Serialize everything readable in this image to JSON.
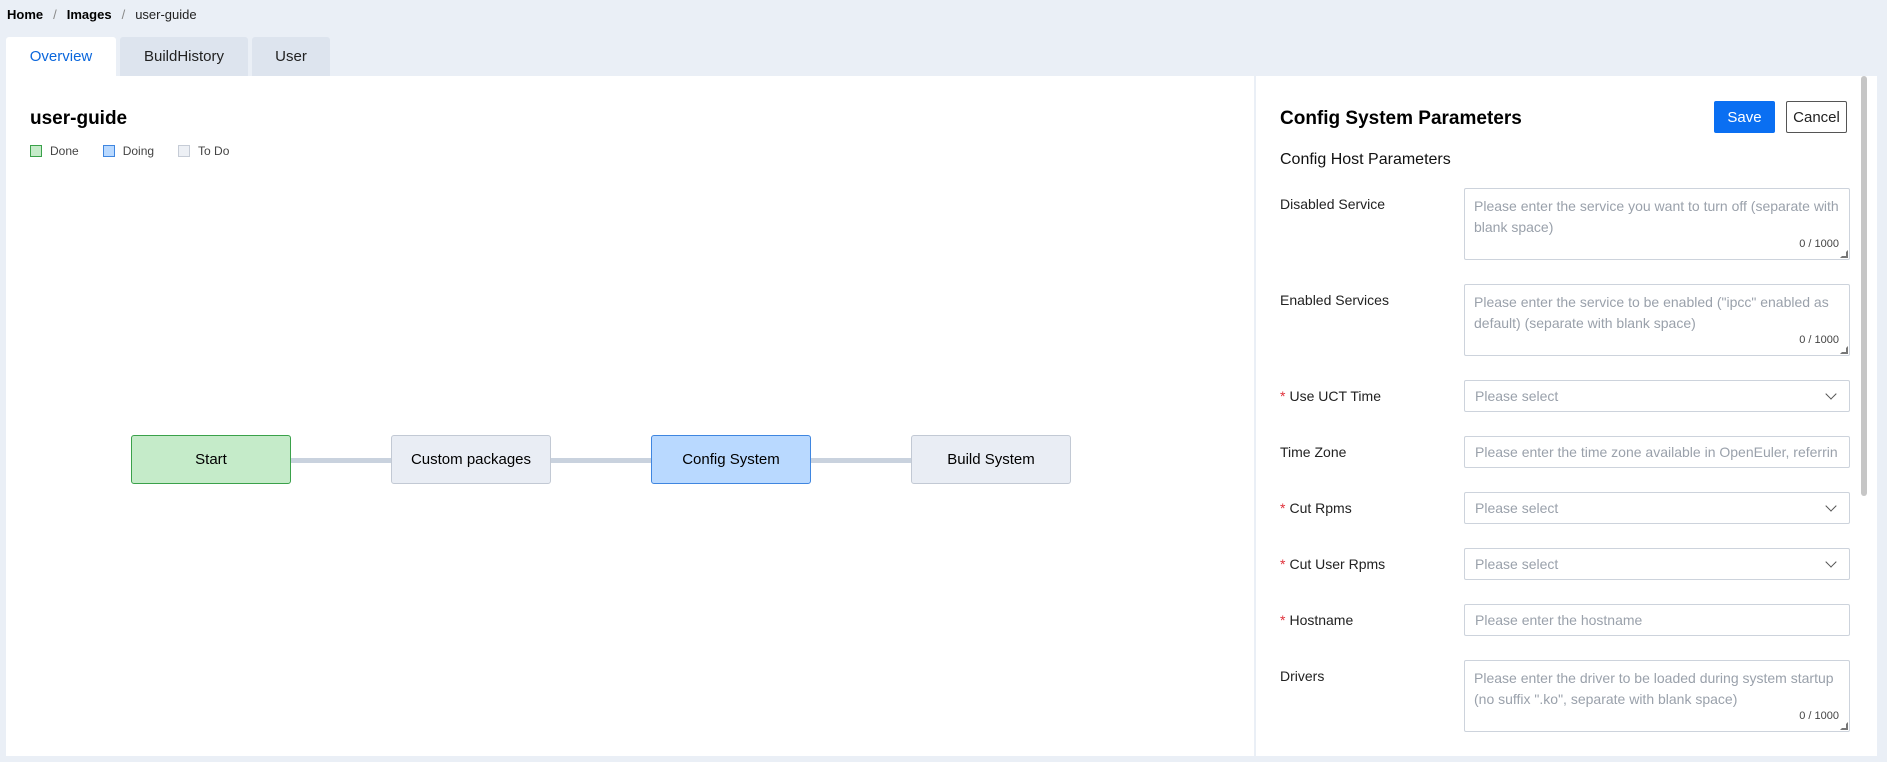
{
  "breadcrumb": {
    "home": "Home",
    "images": "Images",
    "current": "user-guide",
    "separator": "/"
  },
  "tabs": [
    {
      "label": "Overview",
      "active": true
    },
    {
      "label": "BuildHistory",
      "active": false
    },
    {
      "label": "User",
      "active": false
    }
  ],
  "overview": {
    "title": "user-guide",
    "legend": {
      "done": "Done",
      "doing": "Doing",
      "todo": "To Do"
    },
    "steps": [
      {
        "label": "Start",
        "status": "done"
      },
      {
        "label": "Custom packages",
        "status": "todo"
      },
      {
        "label": "Config System",
        "status": "doing"
      },
      {
        "label": "Build System",
        "status": "todo"
      }
    ],
    "colors": {
      "done": "#c5ebc9",
      "doing": "#b9d9ff",
      "todo": "#e9edf4"
    }
  },
  "config": {
    "title": "Config System Parameters",
    "save_label": "Save",
    "cancel_label": "Cancel",
    "subtitle": "Config Host Parameters",
    "required_mark": "*",
    "fields": {
      "disabled_service": {
        "label": "Disabled Service",
        "placeholder": "Please enter the service you want to turn off (separate with blank space)",
        "counter": "0 / 1000"
      },
      "enabled_services": {
        "label": "Enabled Services",
        "placeholder": "Please enter the service to be enabled (\"ipcc\" enabled as default) (separate with blank space)",
        "counter": "0 / 1000"
      },
      "use_uct_time": {
        "label": "Use UCT Time",
        "placeholder": "Please select"
      },
      "time_zone": {
        "label": "Time Zone",
        "placeholder": "Please enter the time zone available in OpenEuler, referrin"
      },
      "cut_rpms": {
        "label": "Cut Rpms",
        "placeholder": "Please select"
      },
      "cut_user_rpms": {
        "label": "Cut User Rpms",
        "placeholder": "Please select"
      },
      "hostname": {
        "label": "Hostname",
        "placeholder": "Please enter the hostname"
      },
      "drivers": {
        "label": "Drivers",
        "placeholder": "Please enter the driver to be loaded during system startup (no suffix \".ko\", separate with blank space)",
        "counter": "0 / 1000"
      }
    },
    "accent_color": "#0a6ff2"
  }
}
